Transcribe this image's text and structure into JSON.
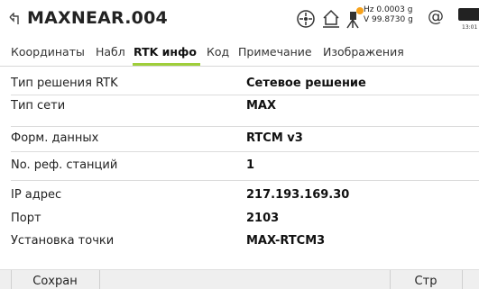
{
  "header": {
    "title": "MAXNEAR.004",
    "hz_label": "Hz 0.0003 g",
    "v_label": "V  99.8730 g",
    "at_symbol": "@",
    "clock": "13:01",
    "icons": [
      "back-icon",
      "sight-icon",
      "home-icon",
      "instrument-warning-icon",
      "battery-icon"
    ],
    "warning_color": "#f7a21b"
  },
  "tabs": [
    {
      "label": "Координаты"
    },
    {
      "label": "Набл"
    },
    {
      "label": "RTK инфо",
      "active": true
    },
    {
      "label": "Код"
    },
    {
      "label": "Примечание"
    },
    {
      "label": "Изображения"
    }
  ],
  "accent_color": "#9fce3a",
  "rows": [
    {
      "label": "Тип решения RTK",
      "value": "Сетевое решение"
    },
    {
      "label": "Тип сети",
      "value": "MAX"
    },
    {
      "label": "Форм. данных",
      "value": "RTCM v3"
    },
    {
      "label": "No. реф. станций",
      "value": "1"
    },
    {
      "label": "IP адрес",
      "value": "217.193.169.30"
    },
    {
      "label": "Порт",
      "value": "2103"
    },
    {
      "label": "Установка точки",
      "value": "MAX-RTCM3"
    }
  ],
  "bottom": {
    "save_label": "Сохран",
    "page_label": "Стр"
  }
}
